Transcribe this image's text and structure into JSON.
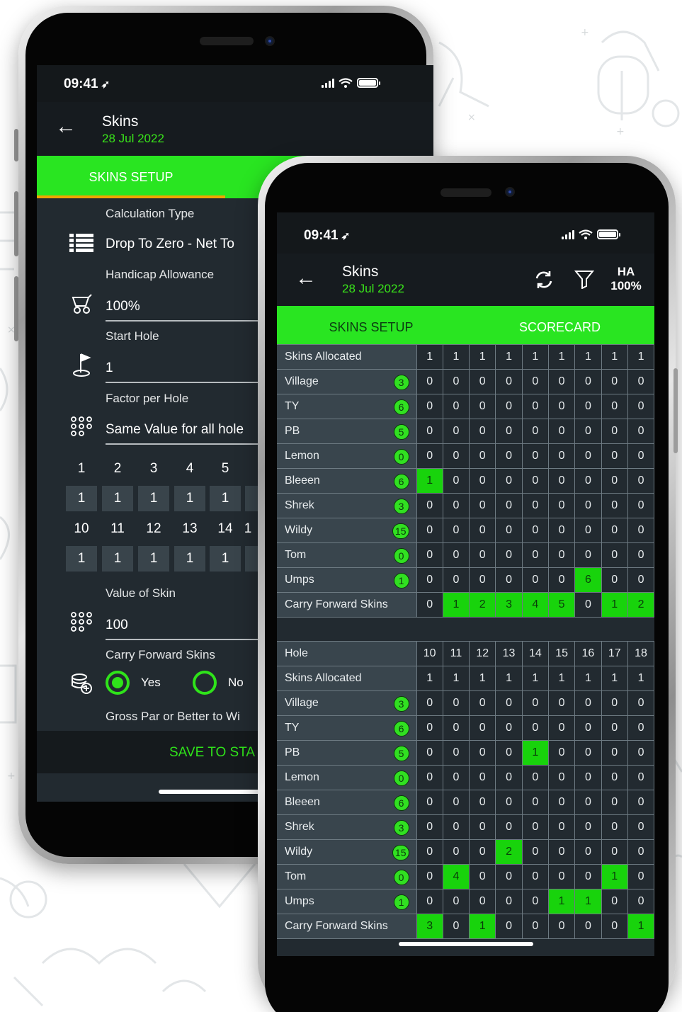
{
  "status": {
    "time": "09:41",
    "location_icon": "location-arrow-icon"
  },
  "back_phone": {
    "app_title": "Skins",
    "app_date": "28 Jul 2022",
    "tab_setup": "SKINS SETUP",
    "calc_type_label": "Calculation Type",
    "calc_type_value": "Drop To Zero - Net To",
    "handicap_label": "Handicap Allowance",
    "handicap_value": "100%",
    "start_hole_label": "Start Hole",
    "start_hole_value": "1",
    "factor_label": "Factor per Hole",
    "factor_value": "Same Value for all hole",
    "holes_row1": [
      "1",
      "2",
      "3",
      "4",
      "5"
    ],
    "factors_row1": [
      "1",
      "1",
      "1",
      "1",
      "1"
    ],
    "holes_row2": [
      "10",
      "11",
      "12",
      "13",
      "14",
      "1"
    ],
    "factors_row2": [
      "1",
      "1",
      "1",
      "1",
      "1"
    ],
    "value_label": "Value of Skin",
    "value_value": "100",
    "carry_label": "Carry Forward Skins",
    "carry_yes": "Yes",
    "carry_no": "No",
    "gross_label": "Gross Par or Better to Wi",
    "save_label": "SAVE TO STA"
  },
  "front_phone": {
    "app_title": "Skins",
    "app_date": "28 Jul 2022",
    "ha_label": "HA",
    "ha_value": "100%",
    "tab_setup": "SKINS SETUP",
    "tab_scorecard": "SCORECARD",
    "front_nine": {
      "allocated_label": "Skins Allocated",
      "allocated": [
        "1",
        "1",
        "1",
        "1",
        "1",
        "1",
        "1",
        "1",
        "1"
      ],
      "players": [
        {
          "name": "Village",
          "badge": "3",
          "scores": [
            "0",
            "0",
            "0",
            "0",
            "0",
            "0",
            "0",
            "0",
            "0"
          ],
          "hl": []
        },
        {
          "name": "TY",
          "badge": "6",
          "scores": [
            "0",
            "0",
            "0",
            "0",
            "0",
            "0",
            "0",
            "0",
            "0"
          ],
          "hl": []
        },
        {
          "name": "PB",
          "badge": "5",
          "scores": [
            "0",
            "0",
            "0",
            "0",
            "0",
            "0",
            "0",
            "0",
            "0"
          ],
          "hl": []
        },
        {
          "name": "Lemon",
          "badge": "0",
          "scores": [
            "0",
            "0",
            "0",
            "0",
            "0",
            "0",
            "0",
            "0",
            "0"
          ],
          "hl": []
        },
        {
          "name": "Bleeen",
          "badge": "6",
          "scores": [
            "1",
            "0",
            "0",
            "0",
            "0",
            "0",
            "0",
            "0",
            "0"
          ],
          "hl": [
            0
          ]
        },
        {
          "name": "Shrek",
          "badge": "3",
          "scores": [
            "0",
            "0",
            "0",
            "0",
            "0",
            "0",
            "0",
            "0",
            "0"
          ],
          "hl": []
        },
        {
          "name": "Wildy",
          "badge": "15",
          "scores": [
            "0",
            "0",
            "0",
            "0",
            "0",
            "0",
            "0",
            "0",
            "0"
          ],
          "hl": []
        },
        {
          "name": "Tom",
          "badge": "0",
          "scores": [
            "0",
            "0",
            "0",
            "0",
            "0",
            "0",
            "0",
            "0",
            "0"
          ],
          "hl": []
        },
        {
          "name": "Umps",
          "badge": "1",
          "scores": [
            "0",
            "0",
            "0",
            "0",
            "0",
            "0",
            "6",
            "0",
            "0"
          ],
          "hl": [
            6
          ]
        }
      ],
      "carry_label": "Carry Forward Skins",
      "carry": [
        "0",
        "1",
        "2",
        "3",
        "4",
        "5",
        "0",
        "1",
        "2"
      ],
      "carry_hl": [
        1,
        2,
        3,
        4,
        5,
        7,
        8
      ]
    },
    "back_nine": {
      "hole_label": "Hole",
      "holes": [
        "10",
        "11",
        "12",
        "13",
        "14",
        "15",
        "16",
        "17",
        "18"
      ],
      "allocated_label": "Skins Allocated",
      "allocated": [
        "1",
        "1",
        "1",
        "1",
        "1",
        "1",
        "1",
        "1",
        "1"
      ],
      "players": [
        {
          "name": "Village",
          "badge": "3",
          "scores": [
            "0",
            "0",
            "0",
            "0",
            "0",
            "0",
            "0",
            "0",
            "0"
          ],
          "hl": []
        },
        {
          "name": "TY",
          "badge": "6",
          "scores": [
            "0",
            "0",
            "0",
            "0",
            "0",
            "0",
            "0",
            "0",
            "0"
          ],
          "hl": []
        },
        {
          "name": "PB",
          "badge": "5",
          "scores": [
            "0",
            "0",
            "0",
            "0",
            "1",
            "0",
            "0",
            "0",
            "0"
          ],
          "hl": [
            4
          ]
        },
        {
          "name": "Lemon",
          "badge": "0",
          "scores": [
            "0",
            "0",
            "0",
            "0",
            "0",
            "0",
            "0",
            "0",
            "0"
          ],
          "hl": []
        },
        {
          "name": "Bleeen",
          "badge": "6",
          "scores": [
            "0",
            "0",
            "0",
            "0",
            "0",
            "0",
            "0",
            "0",
            "0"
          ],
          "hl": []
        },
        {
          "name": "Shrek",
          "badge": "3",
          "scores": [
            "0",
            "0",
            "0",
            "0",
            "0",
            "0",
            "0",
            "0",
            "0"
          ],
          "hl": []
        },
        {
          "name": "Wildy",
          "badge": "15",
          "scores": [
            "0",
            "0",
            "0",
            "2",
            "0",
            "0",
            "0",
            "0",
            "0"
          ],
          "hl": [
            3
          ]
        },
        {
          "name": "Tom",
          "badge": "0",
          "scores": [
            "0",
            "4",
            "0",
            "0",
            "0",
            "0",
            "0",
            "1",
            "0"
          ],
          "hl": [
            1,
            7
          ]
        },
        {
          "name": "Umps",
          "badge": "1",
          "scores": [
            "0",
            "0",
            "0",
            "0",
            "0",
            "1",
            "1",
            "0",
            "0"
          ],
          "hl": [
            5,
            6
          ]
        }
      ],
      "carry_label": "Carry Forward Skins",
      "carry": [
        "3",
        "0",
        "1",
        "0",
        "0",
        "0",
        "0",
        "0",
        "1"
      ],
      "carry_hl": [
        0,
        2,
        8
      ]
    }
  },
  "colors": {
    "accent_green": "#29e521",
    "tab_underline": "#f0a500",
    "screen_bg": "#222a30"
  }
}
